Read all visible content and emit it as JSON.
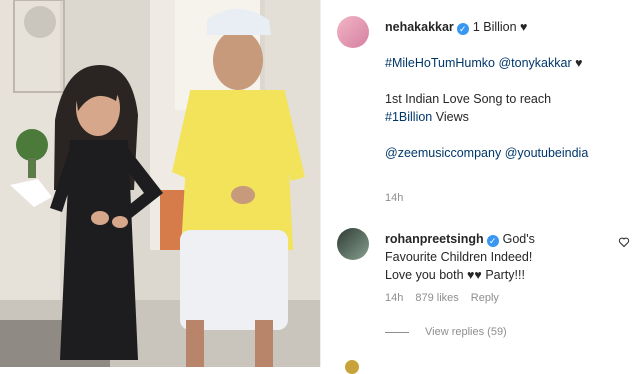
{
  "post": {
    "author": "nehakakkar",
    "caption_lead": "1 Billion ♥",
    "caption_emojis": "⁣⁣⁣⁣",
    "line2_hashtag": "#MileHoTumHumko",
    "line2_mention": "@tonykakkar",
    "line2_suffix": " ♥",
    "line3": "⁣⁣",
    "line4": "1st Indian Love Song to reach",
    "line5_hashtag": "#1Billion",
    "line5_suffix": " Views",
    "line6_mention1": "@zeemusiccompany",
    "line6_mention2": "@youtubeindia",
    "line7": "⁣",
    "time": "14h"
  },
  "comment": {
    "author": "rohanpreetsingh",
    "text1": "God's",
    "text2": "Favourite Children Indeed! ⁣⁣⁣⁣",
    "text3": "Love you both ♥♥ Party!!! ⁣⁣⁣",
    "time": "14h",
    "likes": "879 likes",
    "reply": "Reply",
    "view_replies": "View replies (59)"
  },
  "colors": {
    "link": "#00376b",
    "muted": "#8e8e8e",
    "verified": "#3897f0"
  },
  "icons": {
    "verified": "verified-badge-icon",
    "like": "heart-outline-icon"
  }
}
